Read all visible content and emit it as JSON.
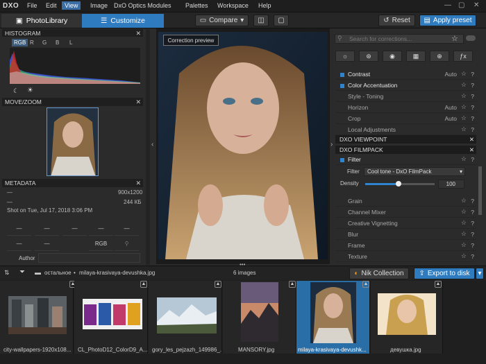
{
  "menubar": {
    "logo": "DXO",
    "items": [
      "File",
      "Edit",
      "View",
      "Image",
      "DxO Optics Modules",
      "Palettes",
      "Workspace",
      "Help"
    ]
  },
  "toolbar": {
    "tab_photolibrary": "PhotoLibrary",
    "tab_customize": "Customize",
    "compare": "Compare",
    "reset": "Reset",
    "apply_preset": "Apply preset"
  },
  "left": {
    "histogram_title": "HISTOGRAM",
    "channels": [
      "RGB",
      "R",
      "G",
      "B",
      "L"
    ],
    "movezoom_title": "MOVE/ZOOM",
    "metadata_title": "METADATA",
    "meta_dim": "900x1200",
    "meta_size": "244 КБ",
    "meta_dash1": "—",
    "meta_dash2": "—",
    "shot_on": "Shot on Tue, Jul 17, 2018 3:06 PM",
    "grid": [
      "—",
      "—",
      "—",
      "—",
      "—",
      "—",
      "—",
      "RGB"
    ],
    "author_label": "Author"
  },
  "viewer": {
    "correction_preview": "Correction preview"
  },
  "right": {
    "search_placeholder": "Search for corrections...",
    "rows_top": [
      {
        "label": "Contrast",
        "auto": "Auto",
        "on": true
      },
      {
        "label": "Color Accentuation",
        "auto": "",
        "on": true
      },
      {
        "label": "Style - Toning",
        "auto": "",
        "on": false
      },
      {
        "label": "Horizon",
        "auto": "Auto",
        "on": false
      },
      {
        "label": "Crop",
        "auto": "Auto",
        "on": false
      },
      {
        "label": "Local Adjustments",
        "auto": "",
        "on": false
      }
    ],
    "section_viewpoint": "DXO VIEWPOINT",
    "section_filmpack": "DXO FILMPACK",
    "filter_label": "Filter",
    "filter_field": "Filter",
    "filter_value": "Cool tone - DxO FilmPack",
    "density_label": "Density",
    "density_value": "100",
    "density_level": 0.48,
    "rows_bottom": [
      "Grain",
      "Channel Mixer",
      "Creative Vignetting",
      "Blur",
      "Frame",
      "Texture"
    ]
  },
  "browser": {
    "path_folder": "остальное",
    "path_file": "milaya-krasivaya-devushka.jpg",
    "count": "6 images",
    "nik": "Nik Collection",
    "export": "Export to disk"
  },
  "thumbs": [
    {
      "name": "city-wallpapers-1920x108..."
    },
    {
      "name": "CL_PhotoD12_ColorD9_A..."
    },
    {
      "name": "gory_les_pejzazh_149986_..."
    },
    {
      "name": "MANSORY.jpg"
    },
    {
      "name": "milaya-krasivaya-devushk...",
      "selected": true
    },
    {
      "name": "девушка.jpg"
    }
  ],
  "colors": {
    "accent": "#2f7bbf",
    "panel": "#2b2b2b",
    "header": "#1f1f1f"
  }
}
